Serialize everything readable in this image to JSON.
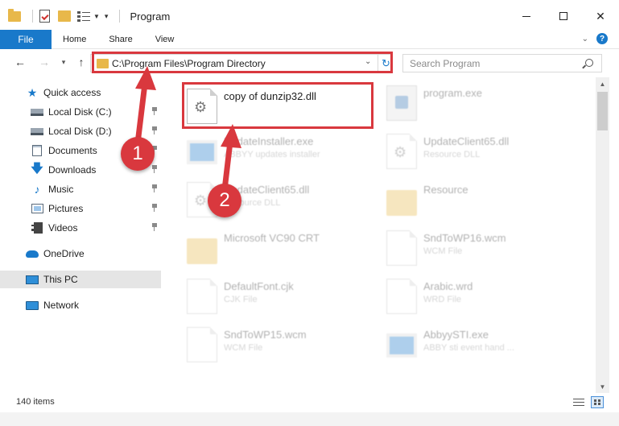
{
  "window": {
    "title": "Program",
    "controls": {
      "minimize": "",
      "maximize": "",
      "close": "✕"
    }
  },
  "ribbon": {
    "file_tab": "File",
    "tabs": [
      "Home",
      "Share",
      "View"
    ],
    "expand_icon": "chevron-down-icon",
    "help_label": "?"
  },
  "address": {
    "path": "C:\\Program Files\\Program Directory",
    "search_placeholder": "Search Program"
  },
  "sidebar": {
    "items": [
      {
        "label": "Quick access",
        "icon": "star-icon",
        "pinned": false
      },
      {
        "label": "Local Disk (C:)",
        "icon": "drive-icon",
        "pinned": true
      },
      {
        "label": "Local Disk (D:)",
        "icon": "drive-icon",
        "pinned": true
      },
      {
        "label": "Documents",
        "icon": "documents-icon",
        "pinned": true
      },
      {
        "label": "Downloads",
        "icon": "download-icon",
        "pinned": true
      },
      {
        "label": "Music",
        "icon": "music-icon",
        "pinned": true
      },
      {
        "label": "Pictures",
        "icon": "pictures-icon",
        "pinned": true
      },
      {
        "label": "Videos",
        "icon": "videos-icon",
        "pinned": true
      },
      {
        "label": "OneDrive",
        "icon": "cloud-icon",
        "pinned": false
      },
      {
        "label": "This PC",
        "icon": "computer-icon",
        "pinned": false,
        "selected": true
      },
      {
        "label": "Network",
        "icon": "network-icon",
        "pinned": false
      }
    ]
  },
  "files": [
    {
      "name": "copy of dunzip32.dll",
      "type": "",
      "icon": "dll-gear-icon",
      "highlighted": true
    },
    {
      "name": "program.exe",
      "type": "",
      "icon": "exe-icon"
    },
    {
      "name": "UpdateInstaller.exe",
      "type": "ABBYY updates installer",
      "icon": "installer-icon"
    },
    {
      "name": "UpdateClient65.dll",
      "type": "Resource DLL",
      "icon": "dll-gear-icon"
    },
    {
      "name": "UpdateClient65.dll",
      "type": "Resource DLL",
      "icon": "dll-gear-icon"
    },
    {
      "name": "Resource",
      "type": "",
      "icon": "folder-icon"
    },
    {
      "name": "Microsoft VC90 CRT",
      "type": "",
      "icon": "folder-icon"
    },
    {
      "name": "SndToWP16.wcm",
      "type": "WCM File",
      "icon": "file-icon"
    },
    {
      "name": "DefaultFont.cjk",
      "type": "CJK File",
      "icon": "file-icon"
    },
    {
      "name": "Arabic.wrd",
      "type": "WRD File",
      "icon": "file-icon"
    },
    {
      "name": "SndToWP15.wcm",
      "type": "WCM File",
      "icon": "file-icon"
    },
    {
      "name": "AbbyySTI.exe",
      "type": "ABBY sti event hand ...",
      "icon": "exe-icon"
    }
  ],
  "status": {
    "item_count": "140 items"
  },
  "annotations": {
    "step1": "1",
    "step2": "2",
    "color": "#d9383e"
  },
  "colors": {
    "accent": "#1979ca",
    "highlight": "#d9383e",
    "folder": "#e8b84a"
  }
}
